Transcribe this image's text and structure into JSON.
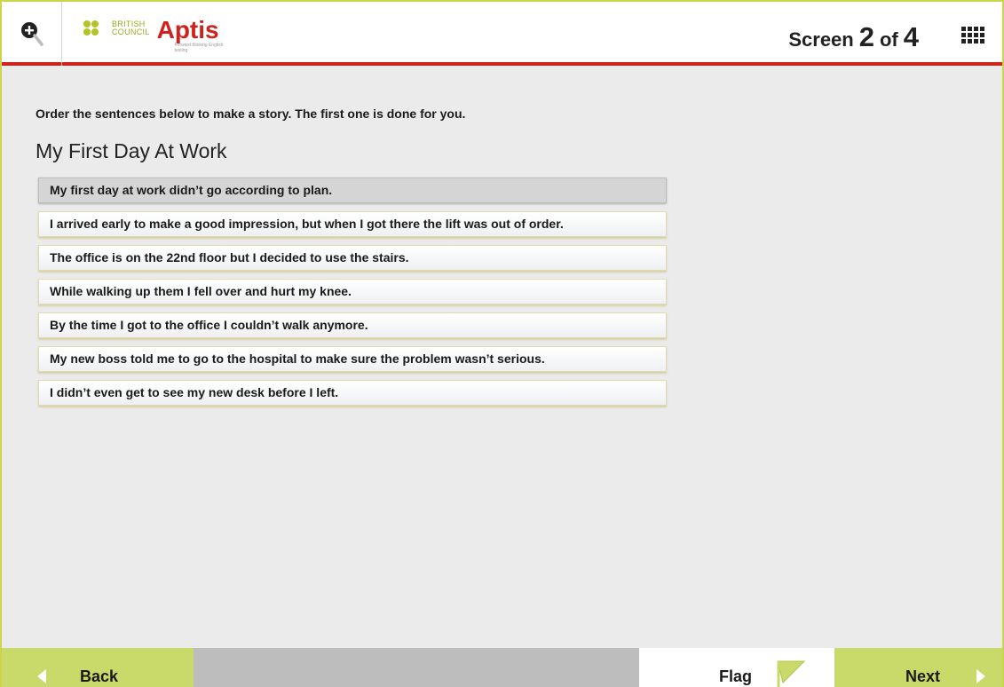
{
  "header": {
    "logo_org_line1": "BRITISH",
    "logo_org_line2": "COUNCIL",
    "logo_product": "Aptis",
    "logo_tagline": "Forward thinking English testing",
    "screen_label": "Screen",
    "screen_current": "2",
    "screen_of": "of",
    "screen_total": "4",
    "zoom_icon": "zoom-in-icon",
    "grid_icon": "grid-icon"
  },
  "main": {
    "instructions": "Order the sentences below to make a story. The first one is done for you.",
    "title": "My First Day At Work",
    "sentences": [
      "My first day at work didn’t go according to plan.",
      "I arrived early to make a good impression, but when I got there the lift was out of order.",
      "The office is on the 22nd floor but I decided to use the stairs.",
      "While walking up them I fell over and hurt my knee.",
      "By the time I got to the office I couldn’t walk anymore.",
      "My new boss told me to go to the hospital to make sure the problem wasn’t serious.",
      "I didn’t even get to see my new desk before I left."
    ]
  },
  "footer": {
    "back_label": "Back",
    "flag_label": "Flag",
    "next_label": "Next"
  },
  "colors": {
    "accent_red": "#d0211c",
    "accent_green": "#c9d96a",
    "frame_green": "#c9d64b",
    "background": "#ebebeb"
  }
}
